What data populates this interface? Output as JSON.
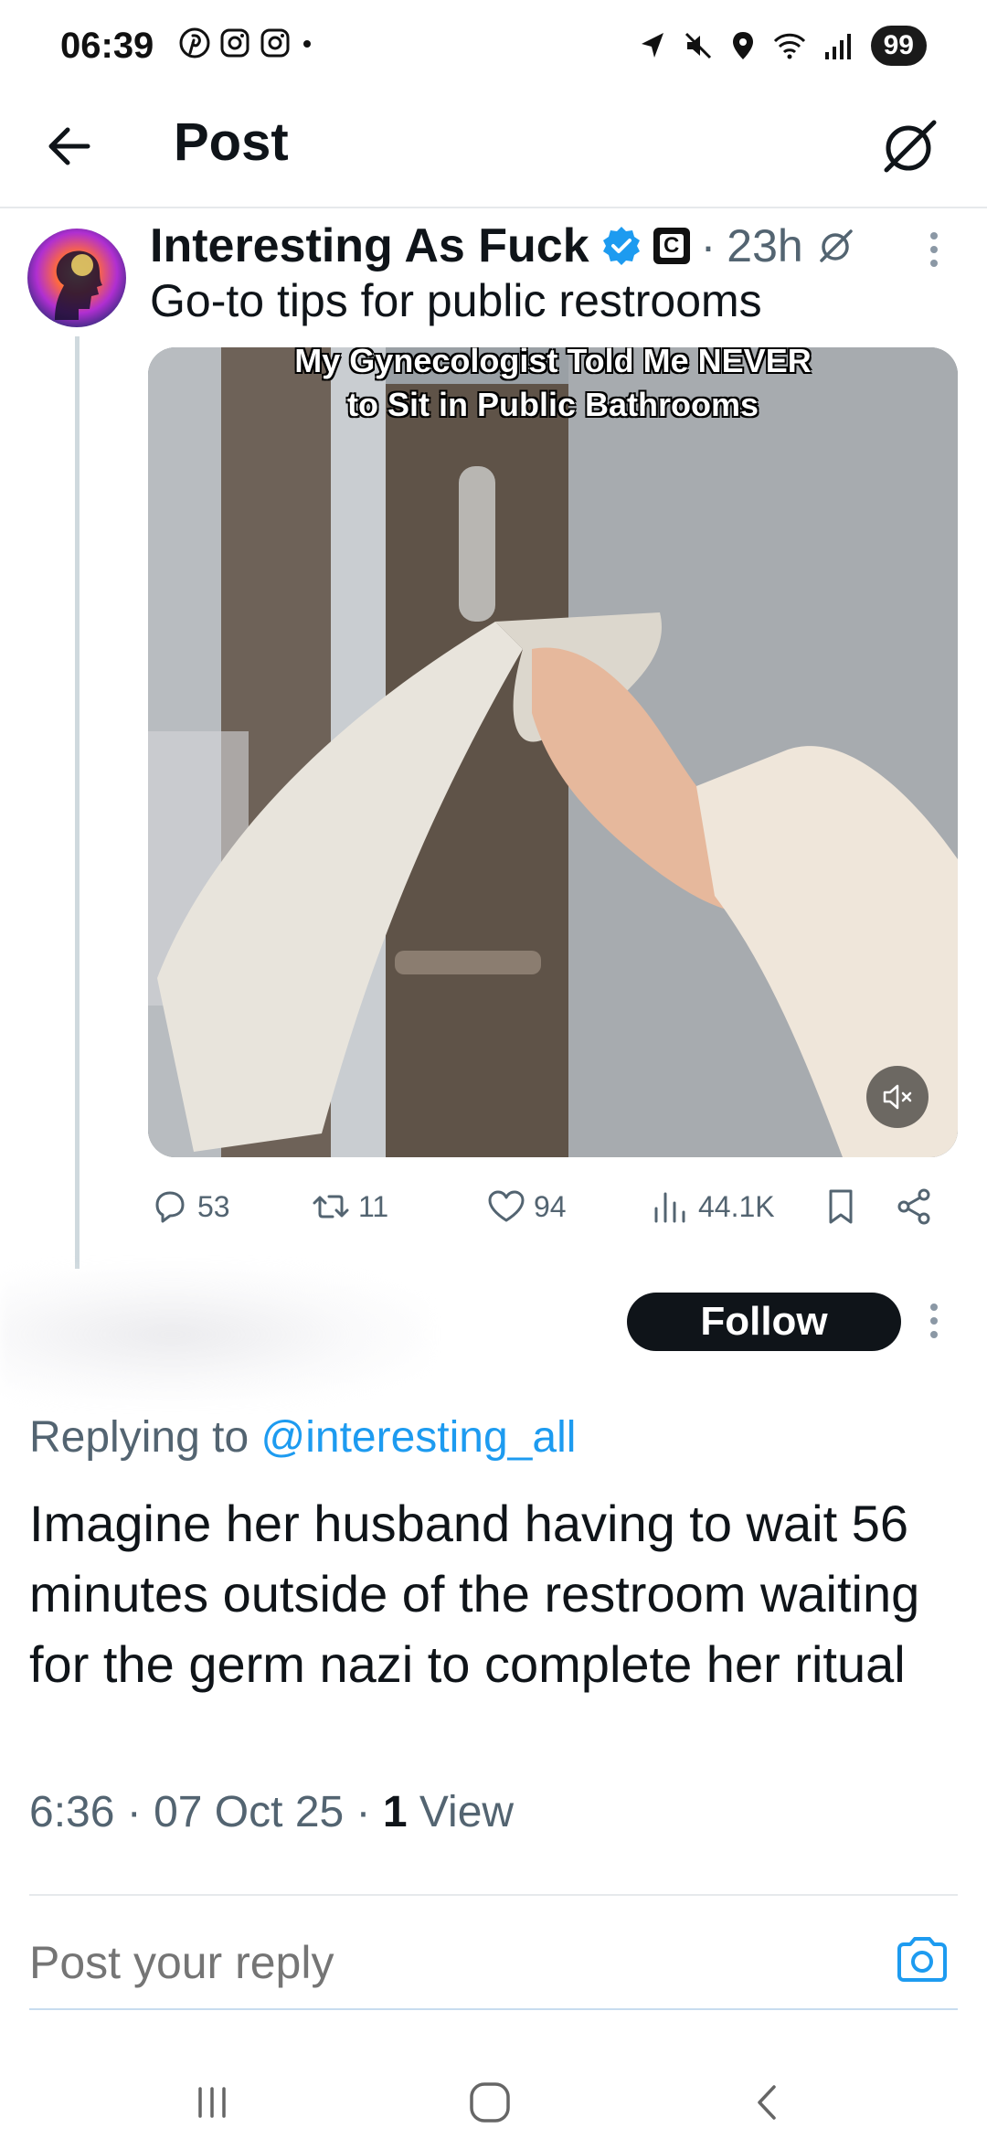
{
  "status_bar": {
    "time": "06:39",
    "battery": "99",
    "left_icons": [
      "pinterest-icon",
      "instagram-icon",
      "instagram-icon",
      "dot-icon"
    ],
    "right_icons": [
      "location-nav-icon",
      "mute-icon",
      "location-pin-icon",
      "wifi-icon",
      "signal-icon"
    ]
  },
  "header": {
    "title": "Post",
    "back_icon": "back-arrow-icon",
    "grok_icon": "grok-icon"
  },
  "tweet": {
    "author": "Interesting As Fuck",
    "verified": true,
    "affiliate_badge": "C",
    "separator": "·",
    "time": "23h",
    "text": "Go-to tips for public restrooms",
    "media": {
      "caption_line1": "My Gynecologist Told Me NEVER",
      "caption_line2": "to Sit in Public Bathrooms"
    },
    "stats": {
      "replies": "53",
      "reposts": "11",
      "likes": "94",
      "views": "44.1K"
    }
  },
  "reply": {
    "follow_label": "Follow",
    "replying_prefix": "Replying to ",
    "replying_handle": "@interesting_all",
    "text": "Imagine her husband having to wait 56 minutes outside of the restroom waiting for the germ nazi to complete her ritual",
    "time": "6:36 · 07 Oct 25 · ",
    "views_count": "1",
    "views_label": " View"
  },
  "composer": {
    "placeholder": "Post your reply"
  },
  "colors": {
    "accent": "#1d9bf0",
    "text_primary": "#0f1419",
    "text_secondary": "#536471",
    "follow_bg": "#0f1419"
  }
}
